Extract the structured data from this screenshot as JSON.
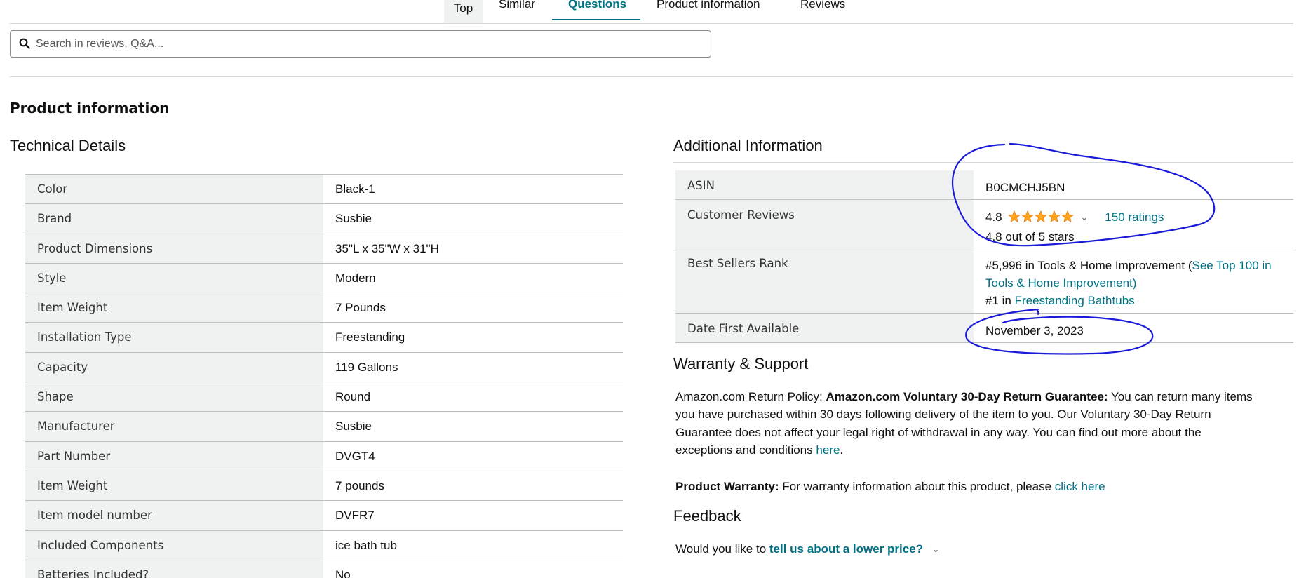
{
  "tabs": [
    {
      "label": "Top"
    },
    {
      "label": "Similar"
    },
    {
      "label": "Questions"
    },
    {
      "label": "Product information"
    },
    {
      "label": "Reviews"
    }
  ],
  "search": {
    "placeholder": "Search in reviews, Q&A...",
    "icon": "search-icon"
  },
  "section_title": "Product information",
  "technical": {
    "title": "Technical Details",
    "rows": [
      {
        "key": "Color",
        "value": "Black-1"
      },
      {
        "key": "Brand",
        "value": "Susbie"
      },
      {
        "key": "Product Dimensions",
        "value": "35\"L x 35\"W x 31\"H"
      },
      {
        "key": "Style",
        "value": "Modern"
      },
      {
        "key": "Item Weight",
        "value": "7 Pounds"
      },
      {
        "key": "Installation Type",
        "value": "Freestanding"
      },
      {
        "key": "Capacity",
        "value": "119 Gallons"
      },
      {
        "key": "Shape",
        "value": "Round"
      },
      {
        "key": "Manufacturer",
        "value": "Susbie"
      },
      {
        "key": "Part Number",
        "value": "DVGT4"
      },
      {
        "key": "Item Weight",
        "value": "7 pounds"
      },
      {
        "key": "Item model number",
        "value": "DVFR7"
      },
      {
        "key": "Included Components",
        "value": "ice bath tub"
      },
      {
        "key": "Batteries Included?",
        "value": "No"
      }
    ]
  },
  "additional": {
    "title": "Additional Information",
    "asin": {
      "key": "ASIN",
      "value": "B0CMCHJ5BN"
    },
    "reviews": {
      "key": "Customer Reviews",
      "rating": "4.8",
      "stars_filled": 5,
      "ratings_link": "150 ratings",
      "out_of": "4.8 out of 5 stars"
    },
    "bsr": {
      "key": "Best Sellers Rank",
      "line1_text": "#5,996 in Tools & Home Improvement (",
      "line1_link": "See Top 100 in Tools & Home Improvement",
      "line1_close": ")",
      "line2_text": "#1 in ",
      "line2_link": "Freestanding Bathtubs"
    },
    "date": {
      "key": "Date First Available",
      "value": "November 3, 2023"
    }
  },
  "warranty": {
    "title": "Warranty & Support",
    "policy_label": "Amazon.com Return Policy:",
    "policy_bold": "Amazon.com Voluntary 30-Day Return Guarantee:",
    "policy_text": "You can return many items you have purchased within 30 days following delivery of the item to you. Our Voluntary 30-Day Return Guarantee does not affect your legal right of withdrawal in any way. You can find out more about the exceptions and conditions",
    "policy_link": "here",
    "policy_end": ".",
    "warranty_label": "Product Warranty:",
    "warranty_text": "For warranty information about this product, please",
    "warranty_link": "click here"
  },
  "feedback": {
    "title": "Feedback",
    "text": "Would you like to",
    "link": "tell us about a lower price?"
  },
  "colors": {
    "link": "#007185",
    "star": "#ffa41c",
    "annotation": "#1a1adb"
  }
}
